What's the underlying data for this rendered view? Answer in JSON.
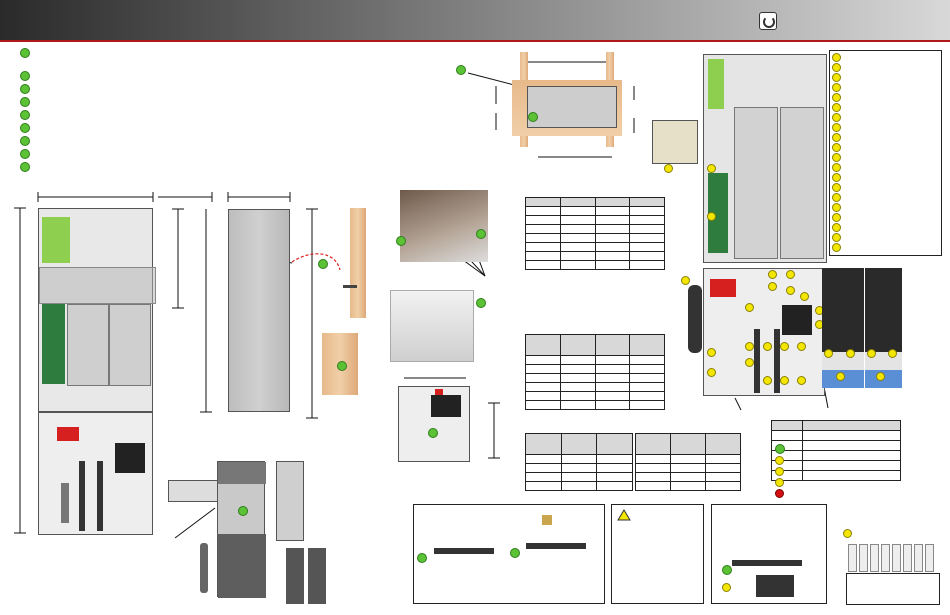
{
  "header": {
    "logo_icon": "outback-logo-icon",
    "bar_color": "#6a6a6a",
    "rule_color": "#b0181c"
  },
  "legend": {
    "colors": {
      "green": "#5bc236",
      "yellow": "#f3e600",
      "red": "#d40f0f"
    }
  },
  "caution": {
    "icon": "warning-triangle-icon"
  }
}
